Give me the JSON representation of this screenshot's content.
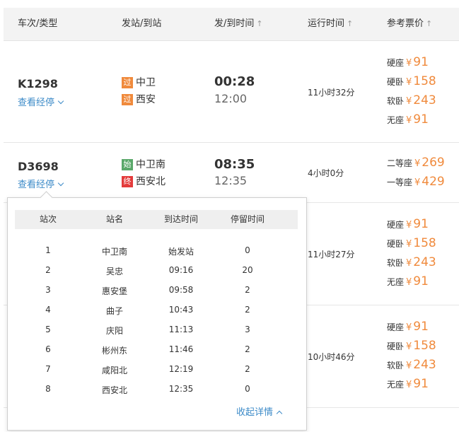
{
  "header": {
    "col_train": "车次/类型",
    "col_station": "发站/到站",
    "col_time": "发/到时间",
    "col_duration": "运行时间",
    "col_price": "参考票价",
    "sort_glyph": "↑"
  },
  "common": {
    "route_link": "查看经停",
    "currency": "¥"
  },
  "trains": [
    {
      "no": "K1298",
      "from_badge": "过",
      "from": "中卫",
      "to_badge": "过",
      "to": "西安",
      "dep": "00:28",
      "arr": "12:00",
      "duration": "11小时32分",
      "prices": [
        {
          "seat": "硬座",
          "value": "91"
        },
        {
          "seat": "硬卧",
          "value": "158"
        },
        {
          "seat": "软卧",
          "value": "243"
        },
        {
          "seat": "无座",
          "value": "91"
        }
      ]
    },
    {
      "no": "D3698",
      "from_badge": "始",
      "from": "中卫南",
      "to_badge": "终",
      "to": "西安北",
      "dep": "08:35",
      "arr": "12:35",
      "duration": "4小时0分",
      "prices": [
        {
          "seat": "二等座",
          "value": "269"
        },
        {
          "seat": "一等座",
          "value": "429"
        }
      ]
    },
    {
      "duration": "11小时27分",
      "prices": [
        {
          "seat": "硬座",
          "value": "91"
        },
        {
          "seat": "硬卧",
          "value": "158"
        },
        {
          "seat": "软卧",
          "value": "243"
        },
        {
          "seat": "无座",
          "value": "91"
        }
      ]
    },
    {
      "duration": "10小时46分",
      "prices": [
        {
          "seat": "硬座",
          "value": "91"
        },
        {
          "seat": "硬卧",
          "value": "158"
        },
        {
          "seat": "软卧",
          "value": "243"
        },
        {
          "seat": "无座",
          "value": "91"
        }
      ]
    }
  ],
  "stops_popup": {
    "headers": [
      "站次",
      "站名",
      "到达时间",
      "停留时间"
    ],
    "rows": [
      [
        "1",
        "中卫南",
        "始发站",
        "0"
      ],
      [
        "2",
        "吴忠",
        "09:16",
        "20"
      ],
      [
        "3",
        "惠安堡",
        "09:58",
        "2"
      ],
      [
        "4",
        "曲子",
        "10:43",
        "2"
      ],
      [
        "5",
        "庆阳",
        "11:13",
        "3"
      ],
      [
        "6",
        "彬州东",
        "11:46",
        "2"
      ],
      [
        "7",
        "咸阳北",
        "12:19",
        "2"
      ],
      [
        "8",
        "西安北",
        "12:35",
        "0"
      ]
    ],
    "collapse_label": "收起详情"
  }
}
